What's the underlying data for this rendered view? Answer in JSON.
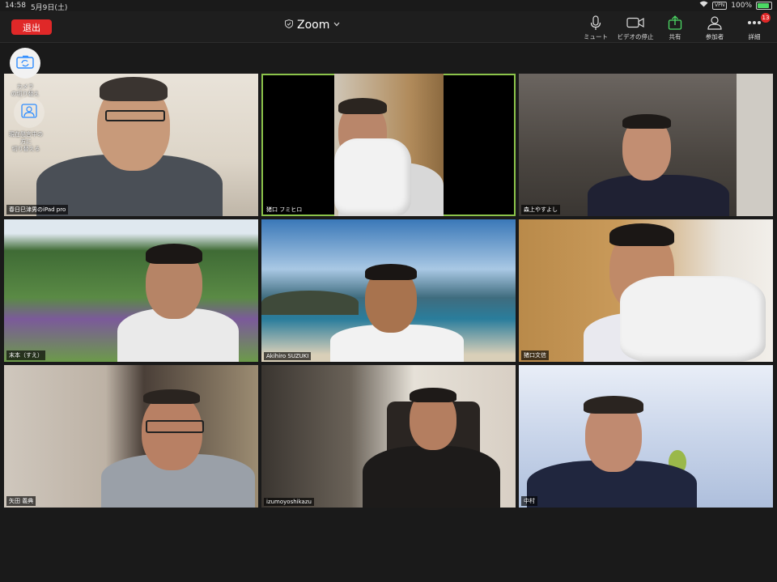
{
  "status_bar": {
    "time": "14:58",
    "date": "5月9日(土)",
    "vpn": "VPN",
    "battery": "100%",
    "battery_level": 1.0
  },
  "meeting": {
    "leave_label": "退出",
    "app_title": "Zoom",
    "title_icon": "shield-icon"
  },
  "toolbar": {
    "mute_label": "ミュート",
    "stop_video_label": "ビデオの停止",
    "share_label": "共有",
    "participants_label": "参加者",
    "more_label": "詳細",
    "more_badge": "13"
  },
  "floating": {
    "switch_camera_label_1": "カメラ",
    "switch_camera_label_2": "の切り替え",
    "switch_speaker_label_1": "現在発言中の",
    "switch_speaker_label_2": "方に",
    "switch_speaker_label_3": "切り替える"
  },
  "participants": [
    {
      "name": "春日巳津男のiPad pro",
      "active": false
    },
    {
      "name": "猪口 フミヒロ",
      "active": true
    },
    {
      "name": "森上やすよし",
      "active": false
    },
    {
      "name": "末本（すえ）",
      "active": false
    },
    {
      "name": "Akihiro SUZUKI",
      "active": false
    },
    {
      "name": "猪口文信",
      "active": false
    },
    {
      "name": "矢田 義典",
      "active": false
    },
    {
      "name": "izumoyoshikazu",
      "active": false
    },
    {
      "name": "中村",
      "active": false
    }
  ],
  "colors": {
    "leave": "#e02828",
    "active_speaker": "#8bc34a",
    "share_icon": "#4cd964"
  }
}
